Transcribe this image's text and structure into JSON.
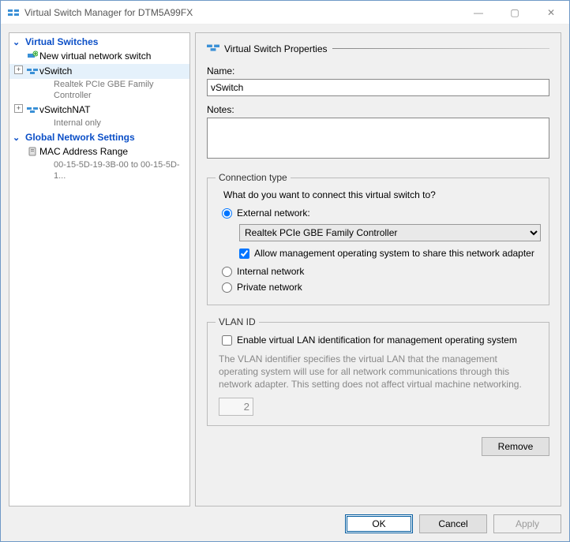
{
  "window": {
    "title": "Virtual Switch Manager for DTM5A99FX",
    "min": "—",
    "max": "▢",
    "close": "✕"
  },
  "tree": {
    "section_switches": "Virtual Switches",
    "new_switch": "New virtual network switch",
    "vswitch": "vSwitch",
    "vswitch_sub": "Realtek PCIe GBE Family Controller",
    "vswitch_nat": "vSwitchNAT",
    "vswitch_nat_sub": "Internal only",
    "section_global": "Global Network Settings",
    "mac_range": "MAC Address Range",
    "mac_range_sub": "00-15-5D-19-3B-00 to 00-15-5D-1..."
  },
  "props": {
    "header": "Virtual Switch Properties",
    "name_label": "Name:",
    "name_value": "vSwitch",
    "notes_label": "Notes:"
  },
  "conn": {
    "legend": "Connection type",
    "prompt": "What do you want to connect this virtual switch to?",
    "external": "External network:",
    "adapter": "Realtek PCIe GBE Family Controller",
    "allow_mgmt": "Allow management operating system to share this network adapter",
    "internal": "Internal network",
    "private": "Private network"
  },
  "vlan": {
    "legend": "VLAN ID",
    "enable": "Enable virtual LAN identification for management operating system",
    "help": "The VLAN identifier specifies the virtual LAN that the management operating system will use for all network communications through this network adapter. This setting does not affect virtual machine networking.",
    "value": "2"
  },
  "buttons": {
    "remove": "Remove",
    "ok": "OK",
    "cancel": "Cancel",
    "apply": "Apply"
  }
}
